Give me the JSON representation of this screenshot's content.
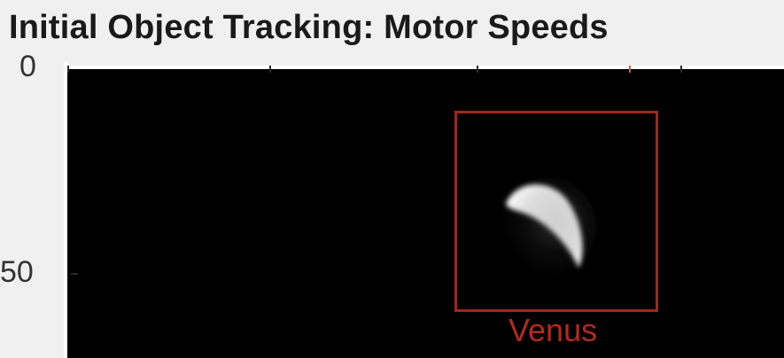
{
  "figure": {
    "title": "Initial Object Tracking: Motor Speeds",
    "y_tick_labels": [
      "0",
      "50"
    ],
    "track_label": "Venus"
  },
  "colors": {
    "background": "#f0f0f0",
    "plot_background": "#000000",
    "track_box": "#a0281c",
    "track_label": "#b32a1c",
    "object": "#ffffff"
  },
  "icons": {
    "tracked_object": "crescent-venus"
  }
}
